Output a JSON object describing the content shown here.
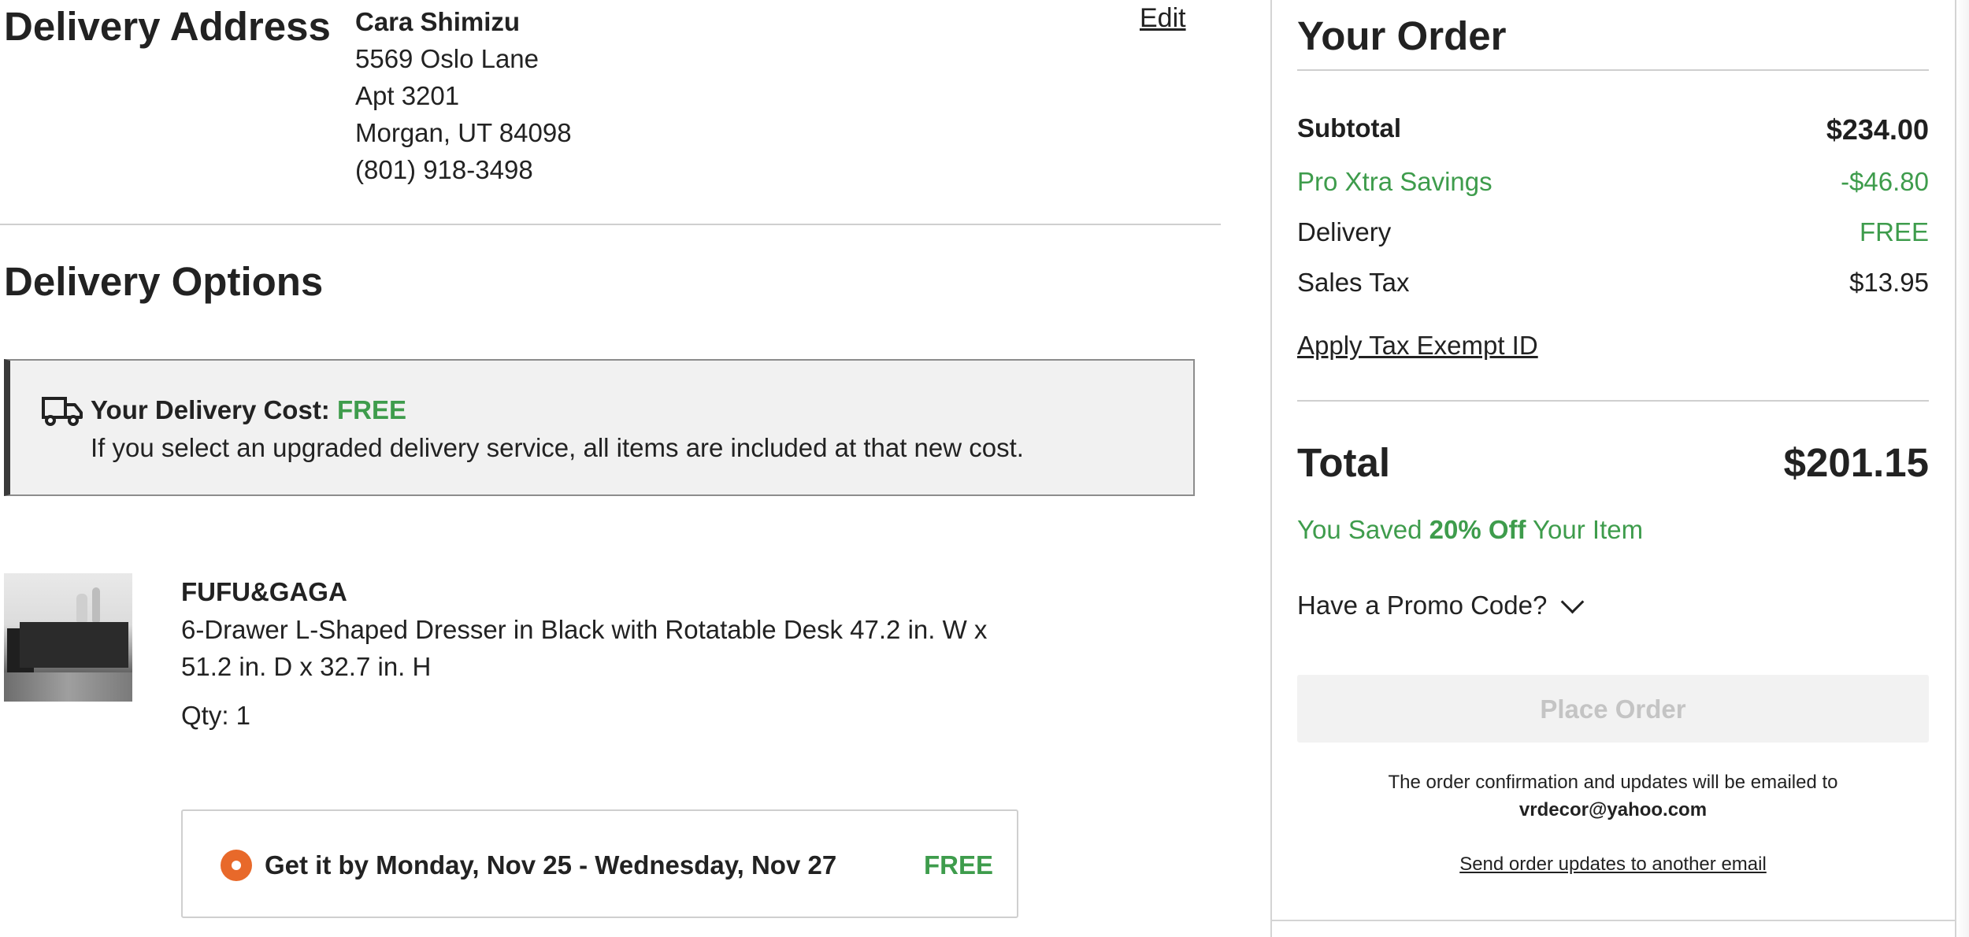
{
  "delivery_address": {
    "title": "Delivery Address",
    "name": "Cara Shimizu",
    "line1": "5569 Oslo Lane",
    "line2": "Apt 3201",
    "city_state_zip": "Morgan, UT 84098",
    "phone": "(801) 918-3498",
    "edit_label": "Edit"
  },
  "delivery_options": {
    "title": "Delivery Options",
    "cost_label": "Your Delivery Cost:",
    "cost_value": "FREE",
    "note": "If you select an upgraded delivery service, all items are included at that new cost.",
    "item": {
      "brand": "FUFU&GAGA",
      "name": "6-Drawer L-Shaped Dresser in Black with Rotatable Desk 47.2 in. W x 51.2 in. D x 32.7 in. H",
      "qty": "Qty: 1"
    },
    "shipping_option": {
      "label": "Get it by Monday, Nov 25 - Wednesday, Nov 27",
      "price": "FREE",
      "selected": true
    }
  },
  "order_summary": {
    "title": "Your Order",
    "subtotal_label": "Subtotal",
    "subtotal_value": "$234.00",
    "savings_label": "Pro Xtra Savings",
    "savings_value": "-$46.80",
    "delivery_label": "Delivery",
    "delivery_value": "FREE",
    "tax_label": "Sales Tax",
    "tax_value": "$13.95",
    "tax_exempt_link": "Apply Tax Exempt ID",
    "total_label": "Total",
    "total_value": "$201.15",
    "saved_prefix": "You Saved ",
    "saved_amount": "20% Off",
    "saved_suffix": " Your Item",
    "promo_label": "Have a Promo Code?",
    "place_order_label": "Place Order",
    "confirmation_text": "The order confirmation and updates will be emailed to",
    "confirmation_email": "vrdecor@yahoo.com",
    "send_updates_link": "Send order updates to another email"
  },
  "colors": {
    "green": "#3e9c4c",
    "radio_orange": "#e8692a",
    "text": "#222222"
  },
  "icons": {
    "truck": "truck-icon",
    "chevron": "chevron-down-icon",
    "radio": "radio-selected-icon"
  }
}
